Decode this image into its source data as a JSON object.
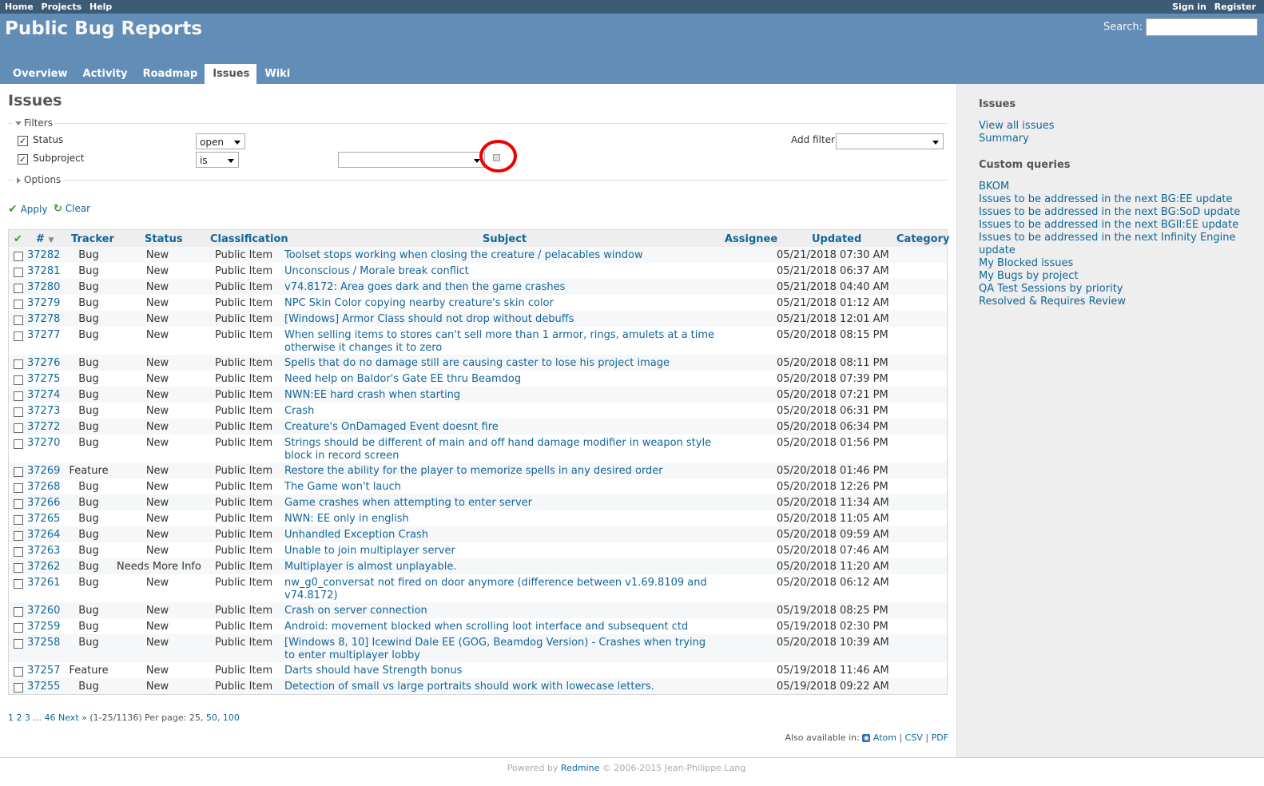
{
  "top_menu": {
    "left": [
      "Home",
      "Projects",
      "Help"
    ],
    "right": [
      "Sign in",
      "Register"
    ]
  },
  "header": {
    "title": "Public Bug Reports",
    "search_label": "Search:"
  },
  "tabs": [
    "Overview",
    "Activity",
    "Roadmap",
    "Issues",
    "Wiki"
  ],
  "selected_tab": "Issues",
  "content": {
    "title": "Issues",
    "filters_legend": "Filters",
    "options_legend": "Options",
    "filters": [
      {
        "label": "Status",
        "operator": "open",
        "checked": true
      },
      {
        "label": "Subproject",
        "operator": "is",
        "checked": true
      }
    ],
    "add_filter_label": "Add filter",
    "apply_label": "Apply",
    "clear_label": "Clear"
  },
  "columns": [
    "#",
    "Tracker",
    "Status",
    "Classification",
    "Subject",
    "Assignee",
    "Updated",
    "Category"
  ],
  "issues": [
    {
      "id": "37282",
      "tracker": "Bug",
      "status": "New",
      "classification": "Public Item",
      "subject": "Toolset stops working when closing the creature / pelacables window",
      "updated": "05/21/2018 07:30 AM"
    },
    {
      "id": "37281",
      "tracker": "Bug",
      "status": "New",
      "classification": "Public Item",
      "subject": "Unconscious / Morale break conflict",
      "updated": "05/21/2018 06:37 AM"
    },
    {
      "id": "37280",
      "tracker": "Bug",
      "status": "New",
      "classification": "Public Item",
      "subject": "v74.8172: Area goes dark and then the game crashes",
      "updated": "05/21/2018 04:40 AM"
    },
    {
      "id": "37279",
      "tracker": "Bug",
      "status": "New",
      "classification": "Public Item",
      "subject": "NPC Skin Color copying nearby creature's skin color",
      "updated": "05/21/2018 01:12 AM"
    },
    {
      "id": "37278",
      "tracker": "Bug",
      "status": "New",
      "classification": "Public Item",
      "subject": "[Windows] Armor Class should not drop without debuffs",
      "updated": "05/21/2018 12:01 AM"
    },
    {
      "id": "37277",
      "tracker": "Bug",
      "status": "New",
      "classification": "Public Item",
      "subject": "When selling items to stores can't sell more than 1 armor, rings, amulets at a time otherwise it changes it to zero",
      "updated": "05/20/2018 08:15 PM"
    },
    {
      "id": "37276",
      "tracker": "Bug",
      "status": "New",
      "classification": "Public Item",
      "subject": "Spells that do no damage still are causing caster to lose his project image",
      "updated": "05/20/2018 08:11 PM"
    },
    {
      "id": "37275",
      "tracker": "Bug",
      "status": "New",
      "classification": "Public Item",
      "subject": "Need help on Baldor's Gate EE thru Beamdog",
      "updated": "05/20/2018 07:39 PM"
    },
    {
      "id": "37274",
      "tracker": "Bug",
      "status": "New",
      "classification": "Public Item",
      "subject": "NWN:EE hard crash when starting",
      "updated": "05/20/2018 07:21 PM"
    },
    {
      "id": "37273",
      "tracker": "Bug",
      "status": "New",
      "classification": "Public Item",
      "subject": "Crash",
      "updated": "05/20/2018 06:31 PM"
    },
    {
      "id": "37272",
      "tracker": "Bug",
      "status": "New",
      "classification": "Public Item",
      "subject": "Creature's OnDamaged Event doesnt fire",
      "updated": "05/20/2018 06:34 PM"
    },
    {
      "id": "37270",
      "tracker": "Bug",
      "status": "New",
      "classification": "Public Item",
      "subject": "Strings should be different of main and off hand damage modifier in weapon style block in record screen",
      "updated": "05/20/2018 01:56 PM"
    },
    {
      "id": "37269",
      "tracker": "Feature",
      "status": "New",
      "classification": "Public Item",
      "subject": "Restore the ability for the player to memorize spells in any desired order",
      "updated": "05/20/2018 01:46 PM"
    },
    {
      "id": "37268",
      "tracker": "Bug",
      "status": "New",
      "classification": "Public Item",
      "subject": "The Game won't lauch",
      "updated": "05/20/2018 12:26 PM"
    },
    {
      "id": "37266",
      "tracker": "Bug",
      "status": "New",
      "classification": "Public Item",
      "subject": "Game crashes when attempting to enter server",
      "updated": "05/20/2018 11:34 AM"
    },
    {
      "id": "37265",
      "tracker": "Bug",
      "status": "New",
      "classification": "Public Item",
      "subject": "NWN: EE only in english",
      "updated": "05/20/2018 11:05 AM"
    },
    {
      "id": "37264",
      "tracker": "Bug",
      "status": "New",
      "classification": "Public Item",
      "subject": "Unhandled Exception Crash",
      "updated": "05/20/2018 09:59 AM"
    },
    {
      "id": "37263",
      "tracker": "Bug",
      "status": "New",
      "classification": "Public Item",
      "subject": "Unable to join multiplayer server",
      "updated": "05/20/2018 07:46 AM"
    },
    {
      "id": "37262",
      "tracker": "Bug",
      "status": "Needs More Info",
      "classification": "Public Item",
      "subject": "Multiplayer is almost unplayable.",
      "updated": "05/20/2018 11:20 AM"
    },
    {
      "id": "37261",
      "tracker": "Bug",
      "status": "New",
      "classification": "Public Item",
      "subject": "nw_g0_conversat not fired on door anymore (difference between v1.69.8109 and v74.8172)",
      "updated": "05/20/2018 06:12 AM"
    },
    {
      "id": "37260",
      "tracker": "Bug",
      "status": "New",
      "classification": "Public Item",
      "subject": "Crash on server connection",
      "updated": "05/19/2018 08:25 PM"
    },
    {
      "id": "37259",
      "tracker": "Bug",
      "status": "New",
      "classification": "Public Item",
      "subject": "Android: movement blocked when scrolling loot interface and subsequent ctd",
      "updated": "05/19/2018 02:30 PM"
    },
    {
      "id": "37258",
      "tracker": "Bug",
      "status": "New",
      "classification": "Public Item",
      "subject": "[Windows 8, 10] Icewind Dale EE (GOG, Beamdog Version) - Crashes when trying to enter multiplayer lobby",
      "updated": "05/20/2018 10:39 AM"
    },
    {
      "id": "37257",
      "tracker": "Feature",
      "status": "New",
      "classification": "Public Item",
      "subject": "Darts should have Strength bonus",
      "updated": "05/19/2018 11:46 AM"
    },
    {
      "id": "37255",
      "tracker": "Bug",
      "status": "New",
      "classification": "Public Item",
      "subject": "Detection of small vs large portraits should work with lowecase letters.",
      "updated": "05/19/2018 09:22 AM"
    }
  ],
  "pagination": {
    "pages": [
      "1",
      "2",
      "3"
    ],
    "ellipsis": "...",
    "last_page": "46",
    "next": "Next »",
    "range": "(1-25/1136)",
    "per_page_label": "Per page:",
    "per_page_current": "25",
    "per_page_options": [
      "50",
      "100"
    ]
  },
  "other_formats": {
    "label": "Also available in:",
    "formats": [
      "Atom",
      "CSV",
      "PDF"
    ]
  },
  "sidebar": {
    "issues_heading": "Issues",
    "issues_links": [
      "View all issues",
      "Summary"
    ],
    "custom_heading": "Custom queries",
    "custom_links": [
      "BKOM",
      "Issues to be addressed in the next BG:EE update",
      "Issues to be addressed in the next BG:SoD update",
      "Issues to be addressed in the next BGII:EE update",
      "Issues to be addressed in the next Infinity Engine",
      "update",
      "My Blocked issues",
      "My Bugs by project",
      "QA Test Sessions by priority",
      "Resolved & Requires Review"
    ]
  },
  "footer": {
    "powered_by": "Powered by",
    "redmine": "Redmine",
    "copyright": "© 2006-2015 Jean-Philippe Lang"
  },
  "colors": {
    "header_bg": "#628db6",
    "top_menu_bg": "#3e5b76",
    "link": "#169",
    "highlight_circle": "#e00"
  }
}
